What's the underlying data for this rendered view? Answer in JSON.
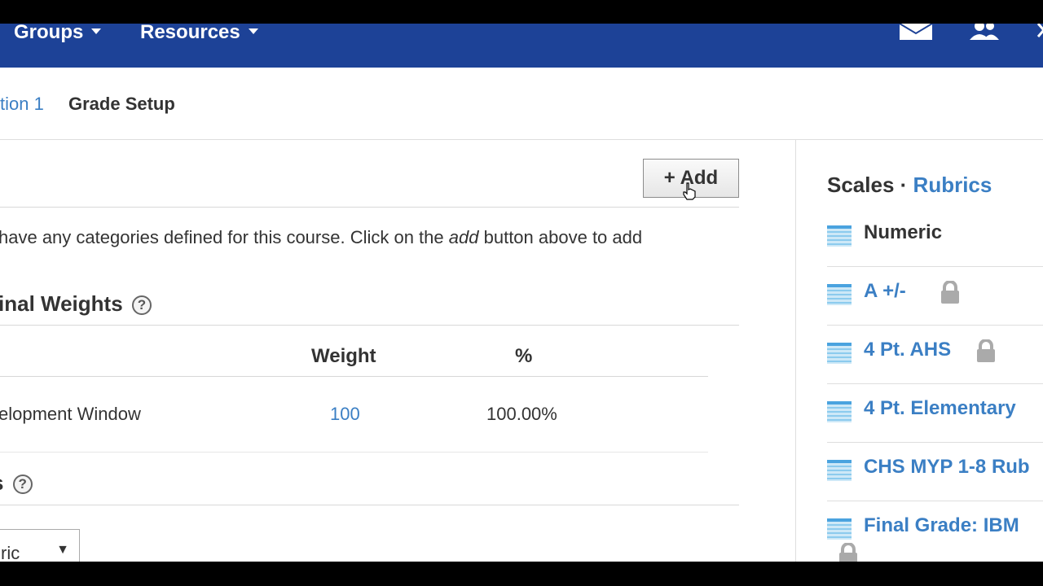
{
  "nav": {
    "groups_label": "Groups",
    "resources_label": "Resources",
    "icons": [
      "mail-icon",
      "people-icon",
      "close-icon"
    ]
  },
  "breadcrumb": {
    "parent": "tion 1",
    "current": "Grade Setup"
  },
  "categories": {
    "add_label": "Add",
    "empty_before": "have any categories defined for this course. Click on the",
    "empty_em": "add",
    "empty_after": "button above to add"
  },
  "final_weights": {
    "title": "inal Weights",
    "columns": {
      "weight": "Weight",
      "percent": "%"
    },
    "rows": [
      {
        "name": "elopment Window",
        "weight": "100",
        "percent": "100.00%"
      }
    ]
  },
  "section_three": {
    "title": "s",
    "select_value": "ric"
  },
  "sidebar": {
    "title_scales": "Scales",
    "separator": "·",
    "title_rubrics": "Rubrics",
    "items": [
      {
        "label": "Numeric",
        "locked": false
      },
      {
        "label": "A +/-",
        "locked": true
      },
      {
        "label": "4 Pt. AHS",
        "locked": true
      },
      {
        "label": "4 Pt. Elementary",
        "locked": false
      },
      {
        "label": "CHS MYP 1-8 Rub",
        "locked": false
      },
      {
        "label": "Final Grade: IBM",
        "locked": true
      }
    ]
  },
  "colors": {
    "nav_bg": "#1d4297",
    "link": "#3b7fc4",
    "text": "#333333"
  }
}
